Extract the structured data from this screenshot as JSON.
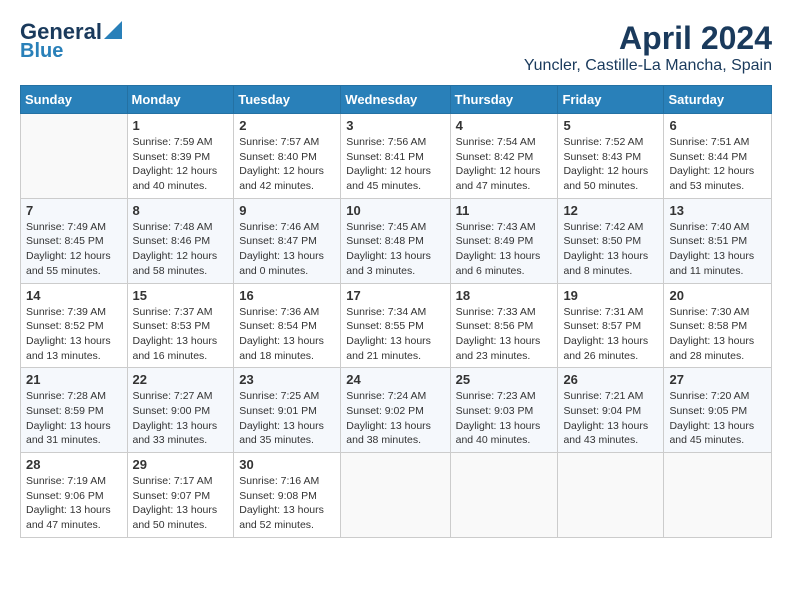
{
  "header": {
    "logo_line1": "General",
    "logo_line2": "Blue",
    "title": "April 2024",
    "subtitle": "Yuncler, Castille-La Mancha, Spain"
  },
  "calendar": {
    "days_of_week": [
      "Sunday",
      "Monday",
      "Tuesday",
      "Wednesday",
      "Thursday",
      "Friday",
      "Saturday"
    ],
    "weeks": [
      [
        {
          "day": "",
          "info": ""
        },
        {
          "day": "1",
          "info": "Sunrise: 7:59 AM\nSunset: 8:39 PM\nDaylight: 12 hours\nand 40 minutes."
        },
        {
          "day": "2",
          "info": "Sunrise: 7:57 AM\nSunset: 8:40 PM\nDaylight: 12 hours\nand 42 minutes."
        },
        {
          "day": "3",
          "info": "Sunrise: 7:56 AM\nSunset: 8:41 PM\nDaylight: 12 hours\nand 45 minutes."
        },
        {
          "day": "4",
          "info": "Sunrise: 7:54 AM\nSunset: 8:42 PM\nDaylight: 12 hours\nand 47 minutes."
        },
        {
          "day": "5",
          "info": "Sunrise: 7:52 AM\nSunset: 8:43 PM\nDaylight: 12 hours\nand 50 minutes."
        },
        {
          "day": "6",
          "info": "Sunrise: 7:51 AM\nSunset: 8:44 PM\nDaylight: 12 hours\nand 53 minutes."
        }
      ],
      [
        {
          "day": "7",
          "info": "Sunrise: 7:49 AM\nSunset: 8:45 PM\nDaylight: 12 hours\nand 55 minutes."
        },
        {
          "day": "8",
          "info": "Sunrise: 7:48 AM\nSunset: 8:46 PM\nDaylight: 12 hours\nand 58 minutes."
        },
        {
          "day": "9",
          "info": "Sunrise: 7:46 AM\nSunset: 8:47 PM\nDaylight: 13 hours\nand 0 minutes."
        },
        {
          "day": "10",
          "info": "Sunrise: 7:45 AM\nSunset: 8:48 PM\nDaylight: 13 hours\nand 3 minutes."
        },
        {
          "day": "11",
          "info": "Sunrise: 7:43 AM\nSunset: 8:49 PM\nDaylight: 13 hours\nand 6 minutes."
        },
        {
          "day": "12",
          "info": "Sunrise: 7:42 AM\nSunset: 8:50 PM\nDaylight: 13 hours\nand 8 minutes."
        },
        {
          "day": "13",
          "info": "Sunrise: 7:40 AM\nSunset: 8:51 PM\nDaylight: 13 hours\nand 11 minutes."
        }
      ],
      [
        {
          "day": "14",
          "info": "Sunrise: 7:39 AM\nSunset: 8:52 PM\nDaylight: 13 hours\nand 13 minutes."
        },
        {
          "day": "15",
          "info": "Sunrise: 7:37 AM\nSunset: 8:53 PM\nDaylight: 13 hours\nand 16 minutes."
        },
        {
          "day": "16",
          "info": "Sunrise: 7:36 AM\nSunset: 8:54 PM\nDaylight: 13 hours\nand 18 minutes."
        },
        {
          "day": "17",
          "info": "Sunrise: 7:34 AM\nSunset: 8:55 PM\nDaylight: 13 hours\nand 21 minutes."
        },
        {
          "day": "18",
          "info": "Sunrise: 7:33 AM\nSunset: 8:56 PM\nDaylight: 13 hours\nand 23 minutes."
        },
        {
          "day": "19",
          "info": "Sunrise: 7:31 AM\nSunset: 8:57 PM\nDaylight: 13 hours\nand 26 minutes."
        },
        {
          "day": "20",
          "info": "Sunrise: 7:30 AM\nSunset: 8:58 PM\nDaylight: 13 hours\nand 28 minutes."
        }
      ],
      [
        {
          "day": "21",
          "info": "Sunrise: 7:28 AM\nSunset: 8:59 PM\nDaylight: 13 hours\nand 31 minutes."
        },
        {
          "day": "22",
          "info": "Sunrise: 7:27 AM\nSunset: 9:00 PM\nDaylight: 13 hours\nand 33 minutes."
        },
        {
          "day": "23",
          "info": "Sunrise: 7:25 AM\nSunset: 9:01 PM\nDaylight: 13 hours\nand 35 minutes."
        },
        {
          "day": "24",
          "info": "Sunrise: 7:24 AM\nSunset: 9:02 PM\nDaylight: 13 hours\nand 38 minutes."
        },
        {
          "day": "25",
          "info": "Sunrise: 7:23 AM\nSunset: 9:03 PM\nDaylight: 13 hours\nand 40 minutes."
        },
        {
          "day": "26",
          "info": "Sunrise: 7:21 AM\nSunset: 9:04 PM\nDaylight: 13 hours\nand 43 minutes."
        },
        {
          "day": "27",
          "info": "Sunrise: 7:20 AM\nSunset: 9:05 PM\nDaylight: 13 hours\nand 45 minutes."
        }
      ],
      [
        {
          "day": "28",
          "info": "Sunrise: 7:19 AM\nSunset: 9:06 PM\nDaylight: 13 hours\nand 47 minutes."
        },
        {
          "day": "29",
          "info": "Sunrise: 7:17 AM\nSunset: 9:07 PM\nDaylight: 13 hours\nand 50 minutes."
        },
        {
          "day": "30",
          "info": "Sunrise: 7:16 AM\nSunset: 9:08 PM\nDaylight: 13 hours\nand 52 minutes."
        },
        {
          "day": "",
          "info": ""
        },
        {
          "day": "",
          "info": ""
        },
        {
          "day": "",
          "info": ""
        },
        {
          "day": "",
          "info": ""
        }
      ]
    ]
  }
}
